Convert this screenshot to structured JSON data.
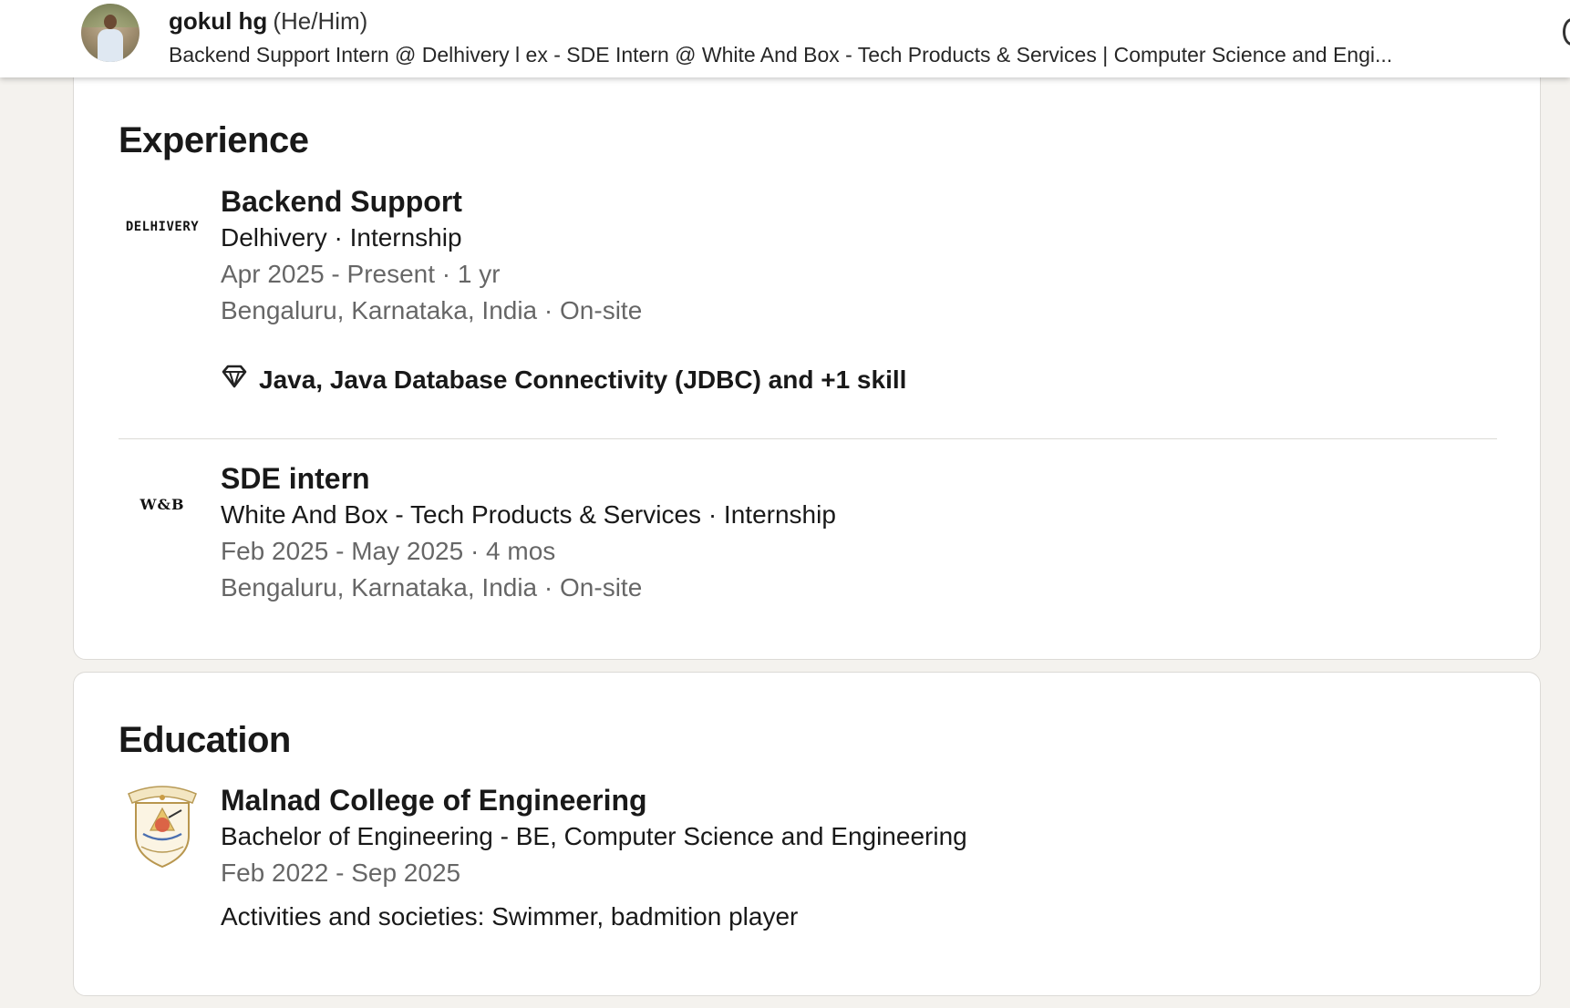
{
  "header": {
    "name": "gokul hg",
    "pronouns": "(He/Him)",
    "headline": "Backend Support Intern @ Delhivery l ex - SDE Intern @ White And Box - Tech Products & Services | Computer Science and Engi...",
    "avatar_icon": "profile-photo"
  },
  "experience": {
    "title": "Experience",
    "items": [
      {
        "logo_text": "DELHIVERY",
        "role": "Backend Support",
        "company_line": "Delhivery · Internship",
        "dates": "Apr 2025 - Present · 1 yr",
        "location": "Bengaluru, Karnataka, India · On-site",
        "skills": "Java, Java Database Connectivity (JDBC) and +1 skill",
        "skills_icon": "diamond-icon"
      },
      {
        "logo_text": "W&B",
        "role": "SDE intern",
        "company_line": "White And Box - Tech Products & Services · Internship",
        "dates": "Feb 2025 - May 2025 · 4 mos",
        "location": "Bengaluru, Karnataka, India · On-site"
      }
    ]
  },
  "education": {
    "title": "Education",
    "items": [
      {
        "school": "Malnad College of Engineering",
        "degree": "Bachelor of Engineering - BE, Computer Science and Engineering",
        "dates": "Feb 2022 - Sep 2025",
        "activities": "Activities and societies: Swimmer, badmition player",
        "logo_icon": "college-crest-icon"
      }
    ]
  },
  "colors": {
    "page_bg": "#f4f2ee",
    "card_bg": "#ffffff",
    "divider": "#dcdad6",
    "muted_text": "#666666"
  }
}
